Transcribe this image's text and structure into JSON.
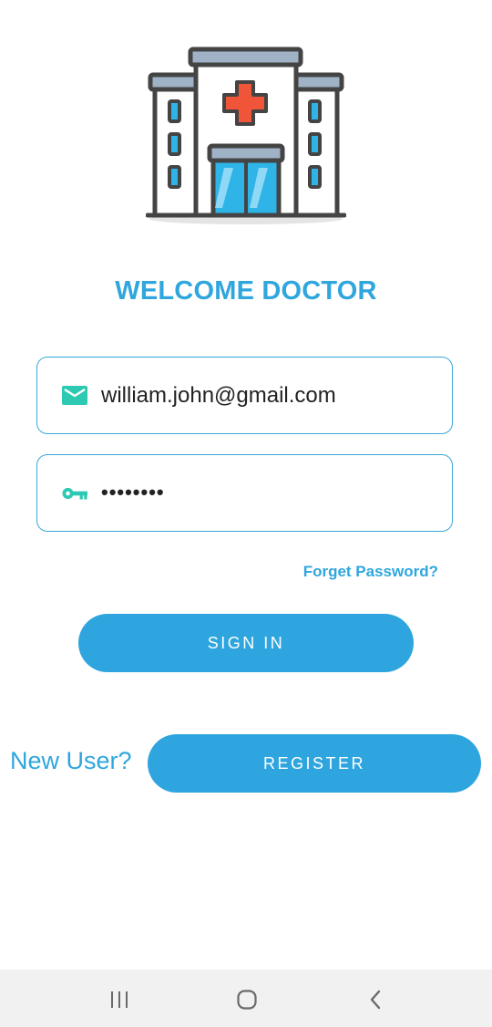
{
  "app": {
    "title": "WELCOME DOCTOR",
    "accent_color": "#2fa6dd",
    "button_color": "#2ea5de",
    "logo_icon": "hospital-icon"
  },
  "login": {
    "email_icon": "mail-icon",
    "email_value": "william.john@gmail.com",
    "password_icon": "key-icon",
    "password_value": "••••••••",
    "icon_color": "#2ec9b3",
    "forgot_label": "Forget Password?",
    "signin_label": "SIGN IN"
  },
  "register": {
    "prompt": "New User?",
    "button_label": "REGISTER"
  },
  "system_nav": {
    "recent_icon": "recent-apps-icon",
    "home_icon": "home-icon",
    "back_icon": "back-icon"
  }
}
